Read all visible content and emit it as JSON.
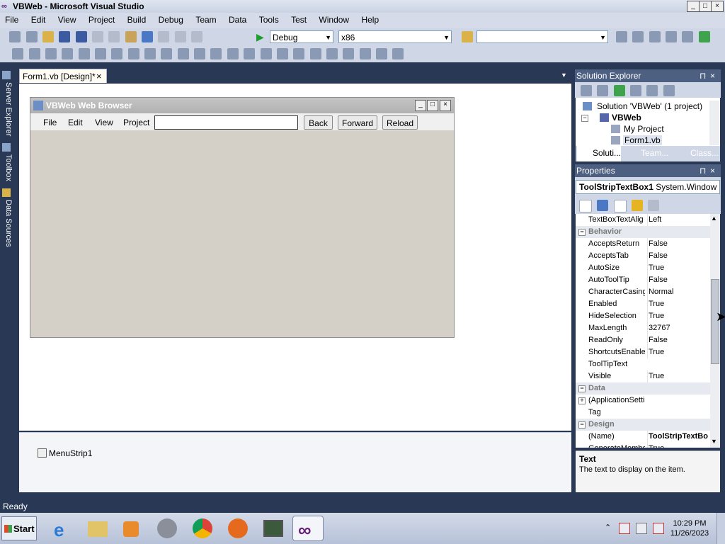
{
  "window": {
    "title": "VBWeb - Microsoft Visual Studio",
    "controls": {
      "minimize": "_",
      "maximize": "□",
      "close": "×"
    }
  },
  "menu": [
    "File",
    "Edit",
    "View",
    "Project",
    "Build",
    "Debug",
    "Team",
    "Data",
    "Tools",
    "Test",
    "Window",
    "Help"
  ],
  "toolbar": {
    "config": "Debug",
    "platform": "x86",
    "find": ""
  },
  "side_tabs": [
    "Server Explorer",
    "Toolbox",
    "Data Sources"
  ],
  "document_tab": {
    "label": "Form1.vb [Design]*",
    "close": "×"
  },
  "form": {
    "title": "VBWeb Web Browser",
    "menu": [
      "File",
      "Edit",
      "View",
      "Project"
    ],
    "address": "",
    "buttons": [
      "Back",
      "Forward",
      "Reload"
    ]
  },
  "tray": {
    "component": "MenuStrip1"
  },
  "solution_explorer": {
    "title": "Solution Explorer",
    "tree": [
      {
        "label": "Solution 'VBWeb' (1 project)",
        "level": 0
      },
      {
        "label": "VBWeb",
        "level": 1,
        "bold": true
      },
      {
        "label": "My Project",
        "level": 2
      },
      {
        "label": "Form1.vb",
        "level": 2,
        "selected": true
      }
    ],
    "tabs": [
      "Soluti...",
      "Team...",
      "Class..."
    ]
  },
  "properties": {
    "title": "Properties",
    "object": "ToolStripTextBox1",
    "object_type": "System.Window",
    "rows": [
      {
        "type": "prop",
        "name": "TextBoxTextAlig",
        "value": "Left"
      },
      {
        "type": "cat",
        "name": "Behavior"
      },
      {
        "type": "prop",
        "name": "AcceptsReturn",
        "value": "False"
      },
      {
        "type": "prop",
        "name": "AcceptsTab",
        "value": "False"
      },
      {
        "type": "prop",
        "name": "AutoSize",
        "value": "True"
      },
      {
        "type": "prop",
        "name": "AutoToolTip",
        "value": "False"
      },
      {
        "type": "prop",
        "name": "CharacterCasing",
        "value": "Normal"
      },
      {
        "type": "prop",
        "name": "Enabled",
        "value": "True"
      },
      {
        "type": "prop",
        "name": "HideSelection",
        "value": "True"
      },
      {
        "type": "prop",
        "name": "MaxLength",
        "value": "32767"
      },
      {
        "type": "prop",
        "name": "ReadOnly",
        "value": "False"
      },
      {
        "type": "prop",
        "name": "ShortcutsEnable",
        "value": "True"
      },
      {
        "type": "prop",
        "name": "ToolTipText",
        "value": ""
      },
      {
        "type": "prop",
        "name": "Visible",
        "value": "True"
      },
      {
        "type": "cat",
        "name": "Data"
      },
      {
        "type": "prop",
        "name": "(ApplicationSetti",
        "value": "",
        "expand": true
      },
      {
        "type": "prop",
        "name": "Tag",
        "value": ""
      },
      {
        "type": "cat",
        "name": "Design"
      },
      {
        "type": "prop",
        "name": "(Name)",
        "value": "ToolStripTextBo",
        "bold": true
      },
      {
        "type": "prop",
        "name": "GenerateMember",
        "value": "True"
      }
    ],
    "description_title": "Text",
    "description_text": "The text to display on the item."
  },
  "status": "Ready",
  "taskbar": {
    "start": "Start",
    "time": "10:29 PM",
    "date": "11/26/2023",
    "apps": [
      "internet-explorer",
      "file-explorer",
      "media-player",
      "chrome-dark",
      "chrome",
      "firefox",
      "task-manager",
      "visual-studio"
    ]
  }
}
